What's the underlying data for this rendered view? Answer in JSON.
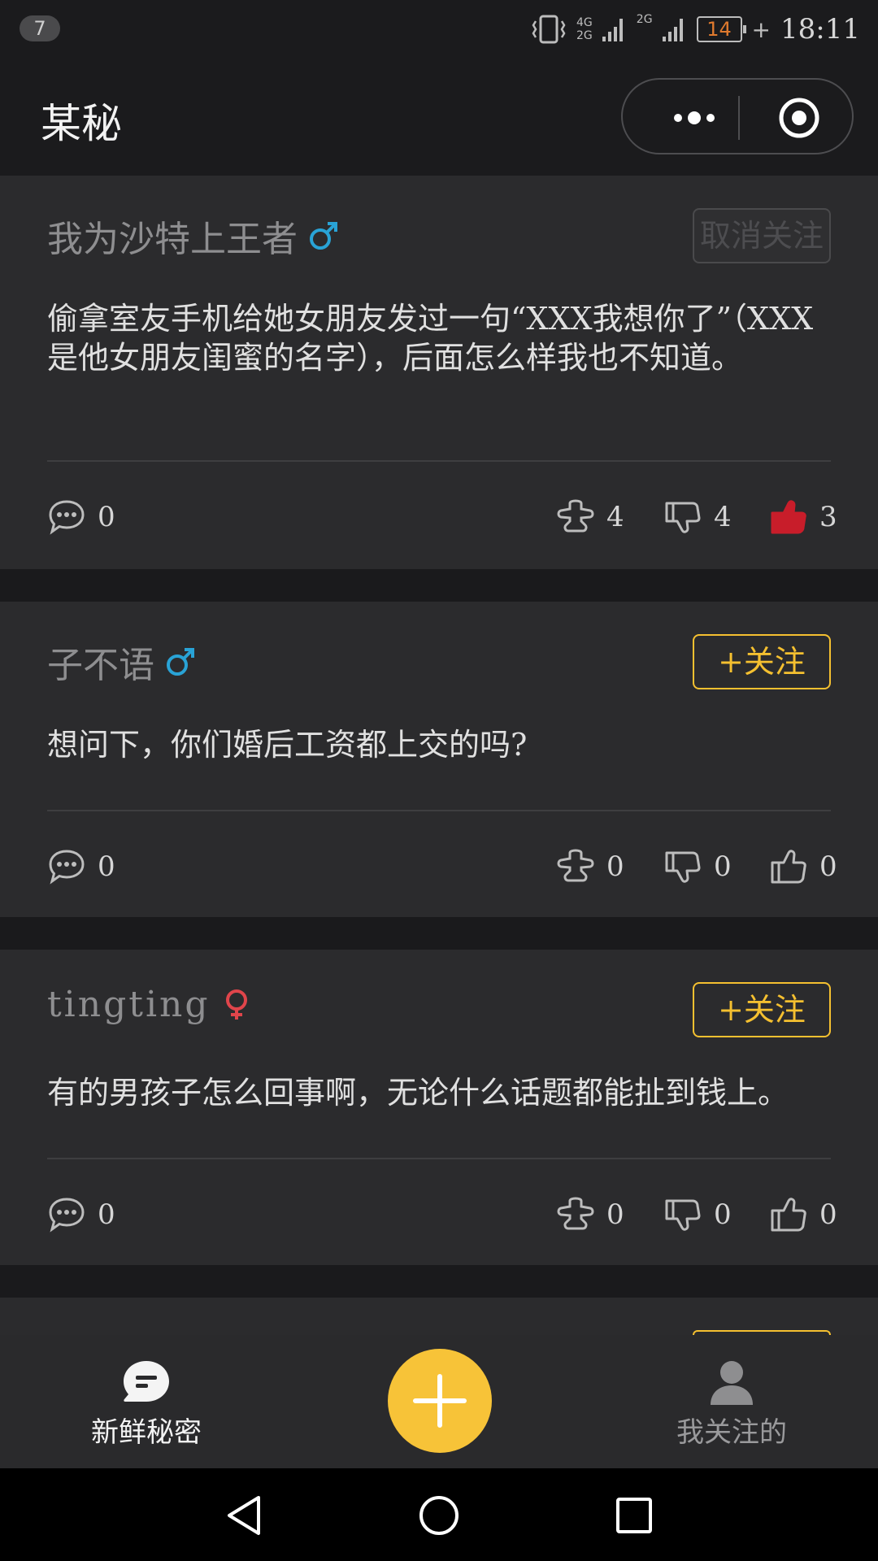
{
  "status_bar": {
    "notification_count": "7",
    "network_label_top": "4G",
    "network_label_bottom": "2G",
    "network_label_2g": "2G",
    "battery_level": "14",
    "charging": "+",
    "time": "18:11",
    "icons": [
      "vibrate-icon",
      "signal-icon",
      "battery-icon"
    ]
  },
  "nav": {
    "title": "某秘",
    "icons": [
      "more-icon",
      "target-icon"
    ]
  },
  "posts": [
    {
      "author": "我为沙特上王者",
      "gender": "male",
      "follow_label": "取消关注",
      "following": true,
      "content": "偷拿室友手机给她女朋友发过一句“XXX我想你了”（XXX是他女朋友闺蜜的名字），后面怎么样我也不知道。",
      "comments": "0",
      "hugs": "4",
      "dislikes": "4",
      "likes": "3",
      "liked": true
    },
    {
      "author": "子不语",
      "gender": "male",
      "follow_label": "+关注",
      "following": false,
      "content": "想问下，你们婚后工资都上交的吗?",
      "comments": "0",
      "hugs": "0",
      "dislikes": "0",
      "likes": "0",
      "liked": false
    },
    {
      "author": "tingting",
      "gender": "female",
      "follow_label": "+关注",
      "following": false,
      "content": "有的男孩子怎么回事啊，无论什么话题都能扯到钱上。",
      "comments": "0",
      "hugs": "0",
      "dislikes": "0",
      "likes": "0",
      "liked": false
    }
  ],
  "tabbar": {
    "fresh_label": "新鲜秘密",
    "follow_label": "我关注的",
    "icons": [
      "chat-bubble-icon",
      "plus-icon",
      "person-icon"
    ]
  },
  "colors": {
    "accent": "#f5c030",
    "male": "#29a3d6",
    "female": "#e0454b",
    "liked": "#c81d2a",
    "background": "#1a1a1c",
    "card": "#2b2b2d"
  }
}
